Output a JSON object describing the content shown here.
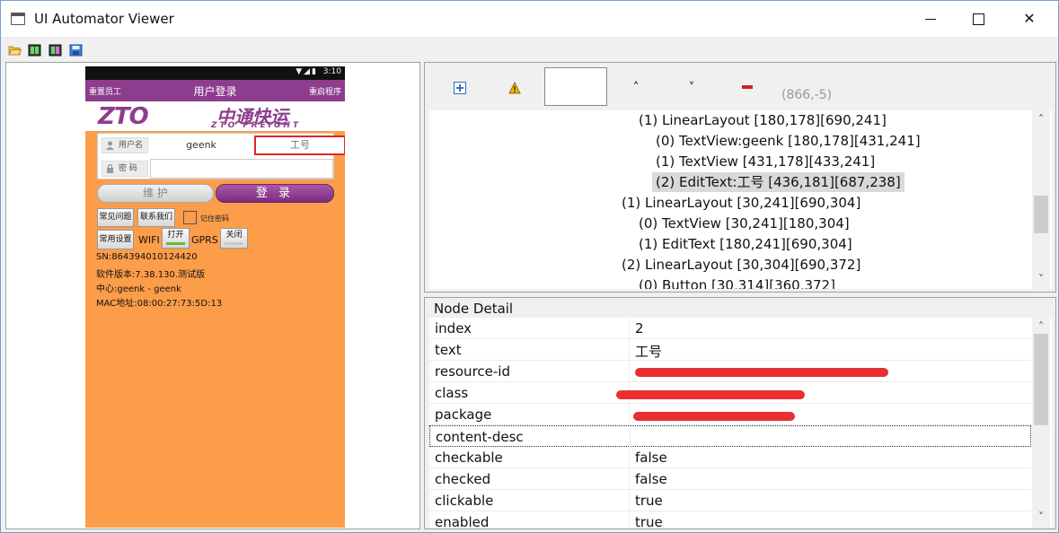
{
  "window": {
    "title": "UI Automator Viewer",
    "min_label": "",
    "max_label": "",
    "close_label": "✕"
  },
  "toolbar": {
    "icons": [
      "open-icon",
      "device-screenshot-icon",
      "device-screenshot-compressed-icon",
      "save-icon"
    ]
  },
  "device": {
    "status_icons": "▼◢▮",
    "status_time": "3:10",
    "header_left": "重置员工",
    "header_center": "用户登录",
    "header_right": "重启程序",
    "logo_zto": "ZTO",
    "logo_cn": "中通快运",
    "logo_en": "ZTO FREIGHT",
    "username_label": "用户名",
    "username_value": "geenk",
    "worker_id": "工号",
    "password_label": "密  码",
    "maintain_button": "维 护",
    "login_button": "登 录",
    "faq_button": "常见问题",
    "contact_button": "联系我们",
    "remember_label": "记住密码",
    "settings_button": "常用设置",
    "wifi_label": "WIFI",
    "open_button": "打开",
    "gprs_label": "GPRS",
    "close_button": "关闭",
    "sn": "SN:864394010124420",
    "version": "软件版本:7.38.130.测试版",
    "center": "中心:geenk - geenk",
    "mac": "MAC地址:08:00:27:73:5D:13"
  },
  "hierarchy_toolbar": {
    "up_label": "˄",
    "down_label": "˅",
    "coords": "(866,-5)"
  },
  "tree": {
    "lines": [
      "(1) LinearLayout [180,178][690,241]",
      "(0) TextView:geenk [180,178][431,241]",
      "(1) TextView [431,178][433,241]",
      "(2) EditText:工号 [436,181][687,238]",
      "(1) LinearLayout [30,241][690,304]",
      "(0) TextView [30,241][180,304]",
      "(1) EditText [180,241][690,304]",
      "(2) LinearLayout [30,304][690,372]",
      "(0) Button [30,314][360,372]"
    ],
    "selected_index": 3
  },
  "node_detail": {
    "title": "Node Detail",
    "rows": [
      {
        "key": "index",
        "value": "2"
      },
      {
        "key": "text",
        "value": "工号"
      },
      {
        "key": "resource-id",
        "value": ""
      },
      {
        "key": "class",
        "value": ""
      },
      {
        "key": "package",
        "value": ""
      },
      {
        "key": "content-desc",
        "value": ""
      },
      {
        "key": "checkable",
        "value": "false"
      },
      {
        "key": "checked",
        "value": "false"
      },
      {
        "key": "clickable",
        "value": "true"
      },
      {
        "key": "enabled",
        "value": "true"
      }
    ]
  },
  "colors": {
    "brand_purple": "#8d3d8e",
    "phone_background": "#fc9d4a",
    "highlight_red": "#e02424",
    "redaction_red": "#e8302f"
  }
}
